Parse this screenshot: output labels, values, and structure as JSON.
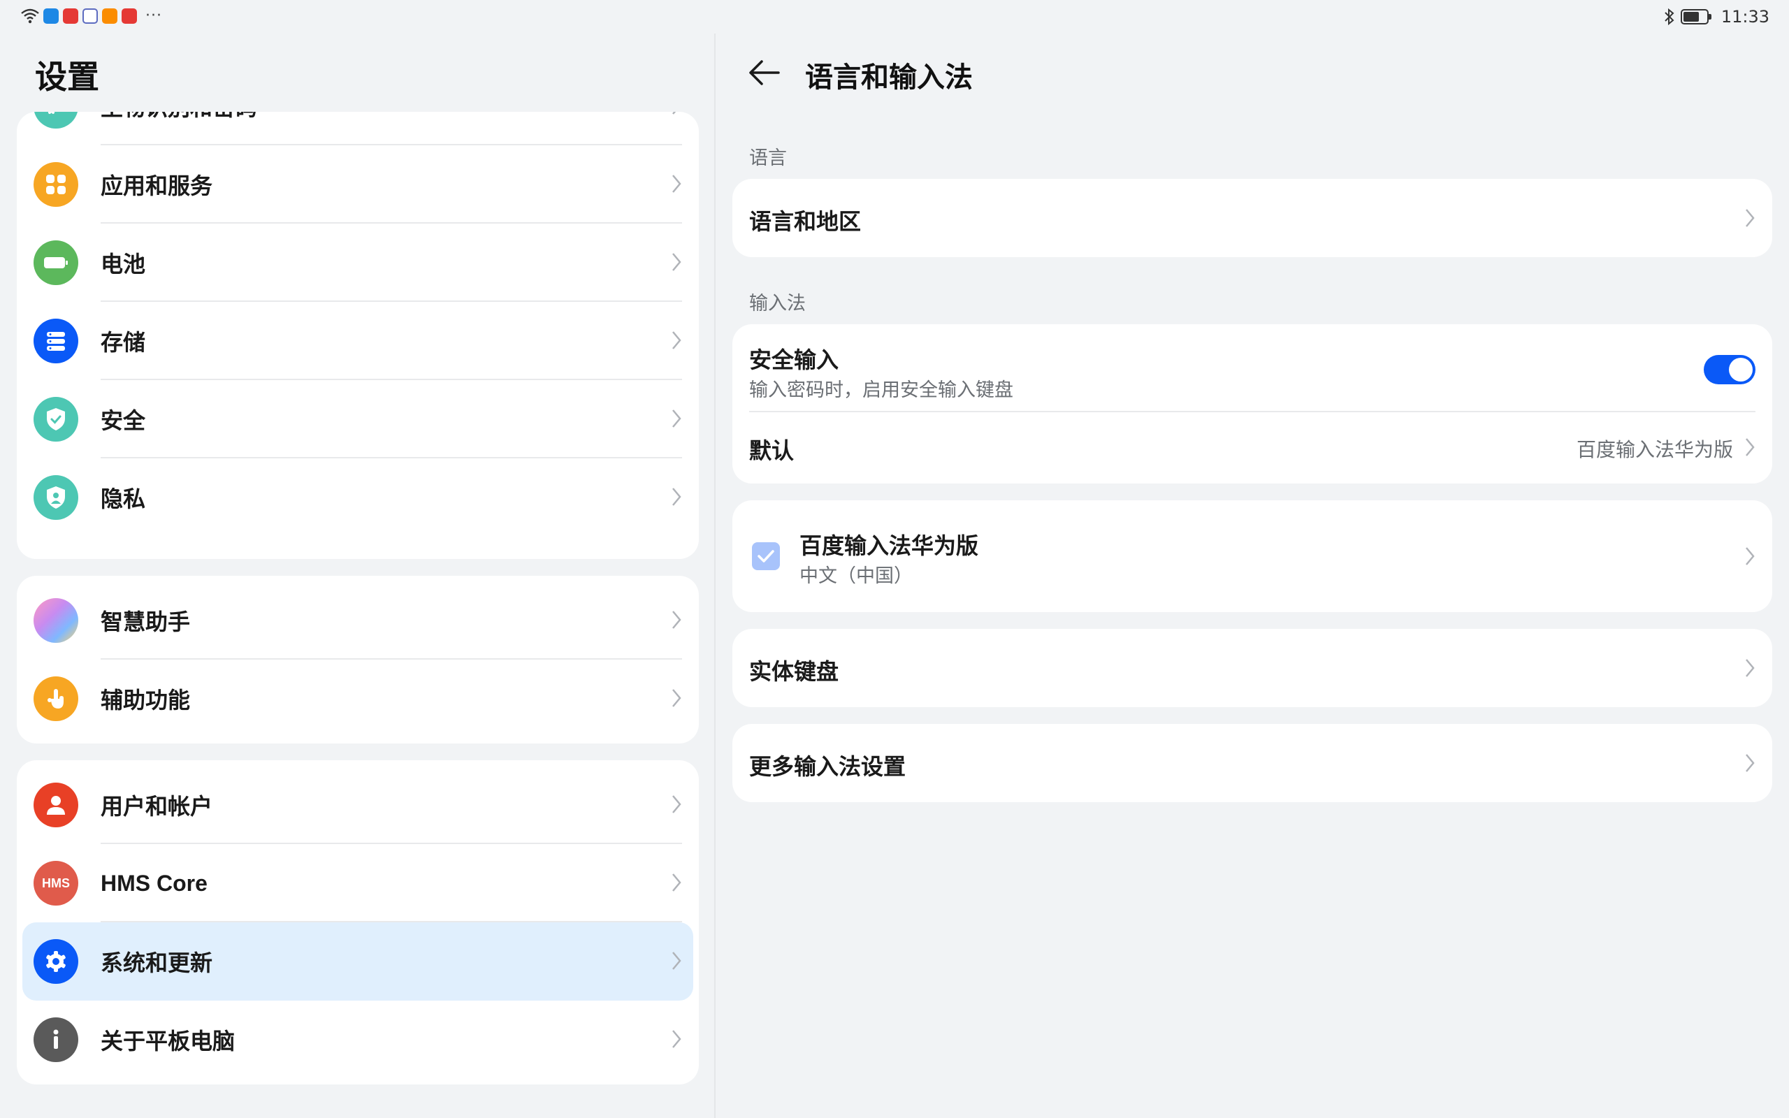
{
  "status_bar": {
    "time": "11:33",
    "left_icons": [
      "wifi-icon",
      "cloud-app-icon",
      "red-app-icon",
      "gallery-app-icon",
      "video-app-icon",
      "shop-app-icon"
    ],
    "more": "···",
    "right_icons": [
      "bluetooth-icon",
      "battery-icon"
    ]
  },
  "left": {
    "title": "设置",
    "groups": [
      {
        "items": [
          {
            "label": "生物识别和密码",
            "icon": "key-icon",
            "color": "#4dc7b3"
          },
          {
            "label": "应用和服务",
            "icon": "apps-icon",
            "color": "#f7a623"
          },
          {
            "label": "电池",
            "icon": "battery-icon",
            "color": "#5cb85c"
          },
          {
            "label": "存储",
            "icon": "storage-icon",
            "color": "#0a59f7"
          },
          {
            "label": "安全",
            "icon": "shield-check-icon",
            "color": "#4dc7b3"
          },
          {
            "label": "隐私",
            "icon": "privacy-shield-icon",
            "color": "#4dc7b3"
          }
        ]
      },
      {
        "items": [
          {
            "label": "智慧助手",
            "icon": "assistant-icon",
            "color": "#c88bf0"
          },
          {
            "label": "辅助功能",
            "icon": "accessibility-hand-icon",
            "color": "#f7a623"
          }
        ]
      },
      {
        "items": [
          {
            "label": "用户和帐户",
            "icon": "user-icon",
            "color": "#e84026"
          },
          {
            "label": "HMS Core",
            "icon": "hms-icon",
            "color": "#e05b4b",
            "icon_text": "HMS"
          },
          {
            "label": "系统和更新",
            "icon": "gear-icon",
            "color": "#0a59f7",
            "selected": true
          },
          {
            "label": "关于平板电脑",
            "icon": "info-icon",
            "color": "#5a5a5a"
          }
        ]
      }
    ]
  },
  "right": {
    "title": "语言和输入法",
    "language_section": "语言",
    "language_region": "语言和地区",
    "input_section": "输入法",
    "secure_input": {
      "title": "安全输入",
      "subtitle": "输入密码时，启用安全输入键盘",
      "enabled": true
    },
    "default_ime": {
      "title": "默认",
      "value": "百度输入法华为版"
    },
    "ime_entry": {
      "title": "百度输入法华为版",
      "subtitle": "中文（中国）",
      "checked": true
    },
    "physical_keyboard": "实体键盘",
    "more_settings": "更多输入法设置"
  }
}
